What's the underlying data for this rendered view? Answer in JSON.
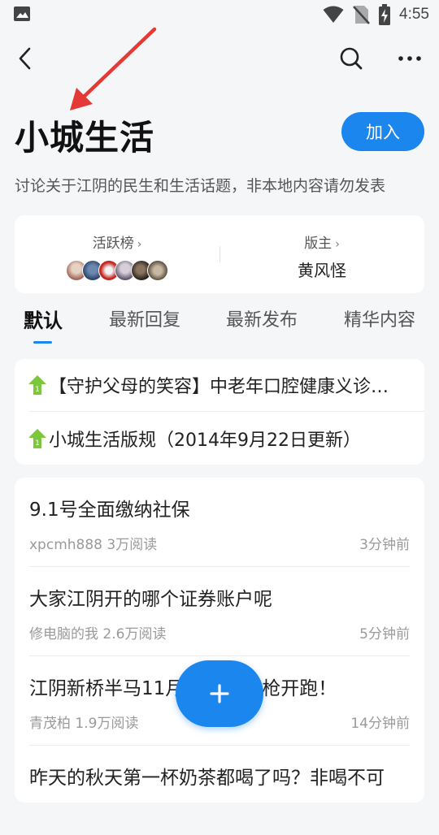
{
  "status_bar": {
    "time": "4:55"
  },
  "header": {
    "back_icon": "back-arrow-icon",
    "search_icon": "search-icon",
    "more_icon": "more-dots-icon"
  },
  "forum": {
    "title": "小城生活",
    "join_label": "加入",
    "description": "讨论关于江阴的民生和生活话题，非本地内容请勿发表"
  },
  "info": {
    "active_label": "活跃榜",
    "moderator_label": "版主",
    "moderator_name": "黄风怪",
    "chevron": "›"
  },
  "tabs": [
    {
      "label": "默认",
      "active": true
    },
    {
      "label": "最新回复",
      "active": false
    },
    {
      "label": "最新发布",
      "active": false
    },
    {
      "label": "精华内容",
      "active": false
    }
  ],
  "pinned": [
    {
      "text": "【守护父母的笑容】中老年口腔健康义诊活动"
    },
    {
      "text": "小城生活版规（2014年9月22日更新）"
    }
  ],
  "posts": [
    {
      "title": "9.1号全面缴纳社保",
      "meta": "xpcmh888 3万阅读",
      "time": "3分钟前"
    },
    {
      "title": "大家江阴开的哪个证券账户呢",
      "meta": "修电脑的我 2.6万阅读",
      "time": "5分钟前"
    },
    {
      "title": "江阴新桥半马11月",
      "title_tail": "枪开跑！",
      "meta": "青茂柏 1.9万阅读",
      "time": "14分钟前"
    },
    {
      "title": "昨天的秋天第一杯奶茶都喝了吗？非喝不可",
      "meta": "",
      "time": ""
    }
  ],
  "colors": {
    "accent": "#1b86ee",
    "arrow": "#e53935",
    "pin": "#7cc83a"
  }
}
